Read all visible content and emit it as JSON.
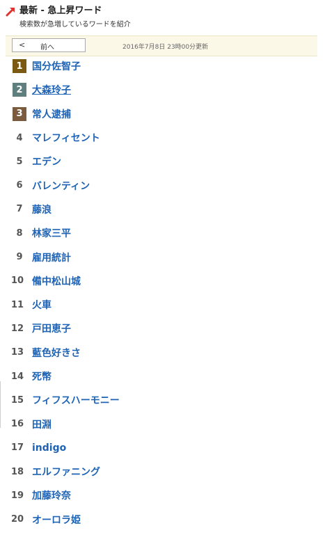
{
  "header": {
    "title": "最新 - 急上昇ワード",
    "subtitle": "検索数が急増しているワードを紹介",
    "icon": "trend-arrow-icon"
  },
  "nav": {
    "prev_chevron": "<",
    "prev_label": "前へ",
    "updated": "2016年7月8日 23時00分更新"
  },
  "colors": {
    "link": "#1f63b4",
    "rank1": "#7a5a12",
    "rank2": "#5f7f7f",
    "rank3": "#7b5b3e",
    "nav_bg": "#fbf8e8"
  },
  "ranking": [
    {
      "rank": "1",
      "word": "国分佐智子"
    },
    {
      "rank": "2",
      "word": "大森玲子"
    },
    {
      "rank": "3",
      "word": "常人逮捕"
    },
    {
      "rank": "4",
      "word": "マレフィセント"
    },
    {
      "rank": "5",
      "word": "エデン"
    },
    {
      "rank": "6",
      "word": "バレンティン"
    },
    {
      "rank": "7",
      "word": "藤浪"
    },
    {
      "rank": "8",
      "word": "林家三平"
    },
    {
      "rank": "9",
      "word": "雇用統計"
    },
    {
      "rank": "10",
      "word": "備中松山城"
    },
    {
      "rank": "11",
      "word": "火車"
    },
    {
      "rank": "12",
      "word": "戸田恵子"
    },
    {
      "rank": "13",
      "word": "藍色好きさ"
    },
    {
      "rank": "14",
      "word": "死幣"
    },
    {
      "rank": "15",
      "word": "フィフスハーモニー"
    },
    {
      "rank": "16",
      "word": "田淵"
    },
    {
      "rank": "17",
      "word": "indigo"
    },
    {
      "rank": "18",
      "word": "エルファニング"
    },
    {
      "rank": "19",
      "word": "加藤玲奈"
    },
    {
      "rank": "20",
      "word": "オーロラ姫"
    }
  ]
}
